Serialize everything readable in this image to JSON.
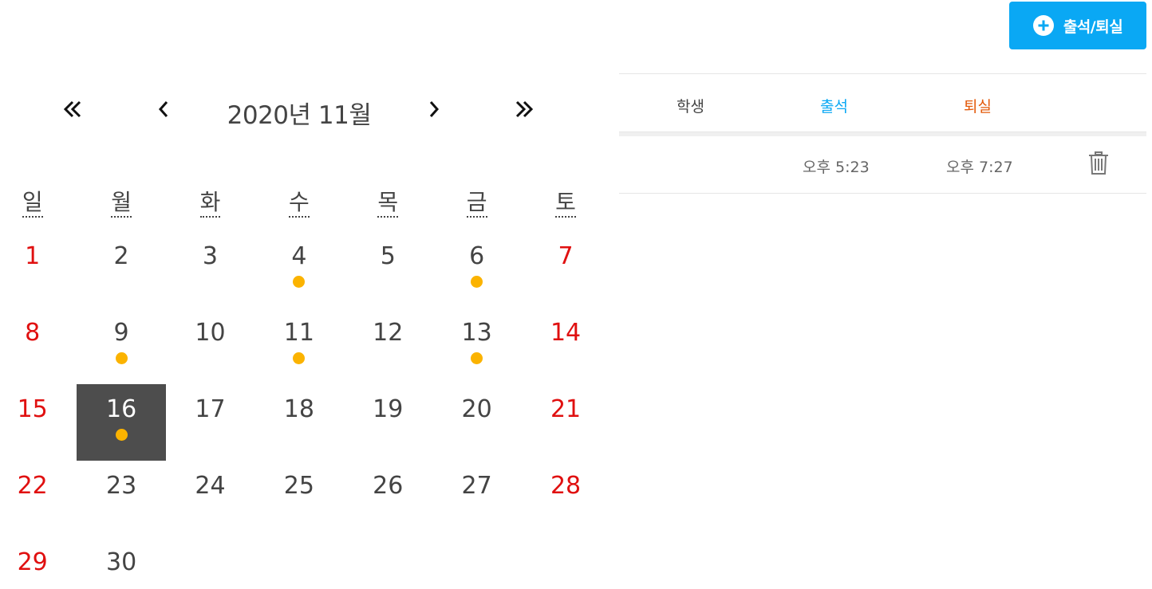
{
  "action_button": {
    "label": "출석/퇴실",
    "icon": "plus-circle-icon",
    "color": "#0aa8f4"
  },
  "calendar": {
    "title": "2020년 11월",
    "nav": {
      "prev_year": "«",
      "prev_month": "‹",
      "next_month": "›",
      "next_year": "»"
    },
    "weekdays": [
      "일",
      "월",
      "화",
      "수",
      "목",
      "금",
      "토"
    ],
    "days": [
      {
        "n": "1"
      },
      {
        "n": "2"
      },
      {
        "n": "3"
      },
      {
        "n": "4",
        "dot": true
      },
      {
        "n": "5"
      },
      {
        "n": "6",
        "dot": true
      },
      {
        "n": "7"
      },
      {
        "n": "8"
      },
      {
        "n": "9",
        "dot": true
      },
      {
        "n": "10"
      },
      {
        "n": "11",
        "dot": true
      },
      {
        "n": "12"
      },
      {
        "n": "13",
        "dot": true
      },
      {
        "n": "14"
      },
      {
        "n": "15"
      },
      {
        "n": "16",
        "dot": true,
        "selected": true
      },
      {
        "n": "17"
      },
      {
        "n": "18"
      },
      {
        "n": "19"
      },
      {
        "n": "20"
      },
      {
        "n": "21"
      },
      {
        "n": "22"
      },
      {
        "n": "23"
      },
      {
        "n": "24"
      },
      {
        "n": "25"
      },
      {
        "n": "26"
      },
      {
        "n": "27"
      },
      {
        "n": "28"
      },
      {
        "n": "29"
      },
      {
        "n": "30"
      }
    ],
    "colors": {
      "weekend": "#e01010",
      "selected_bg": "#4d4d4d",
      "dot": "#fbb300"
    }
  },
  "table": {
    "headers": {
      "student": "학생",
      "in": "출석",
      "out": "퇴실"
    },
    "rows": [
      {
        "student": "",
        "in": "오후 5:23",
        "out": "오후 7:27",
        "action_icon": "trash-icon"
      }
    ],
    "colors": {
      "in": "#0aa8f4",
      "out": "#e35a0b"
    }
  }
}
